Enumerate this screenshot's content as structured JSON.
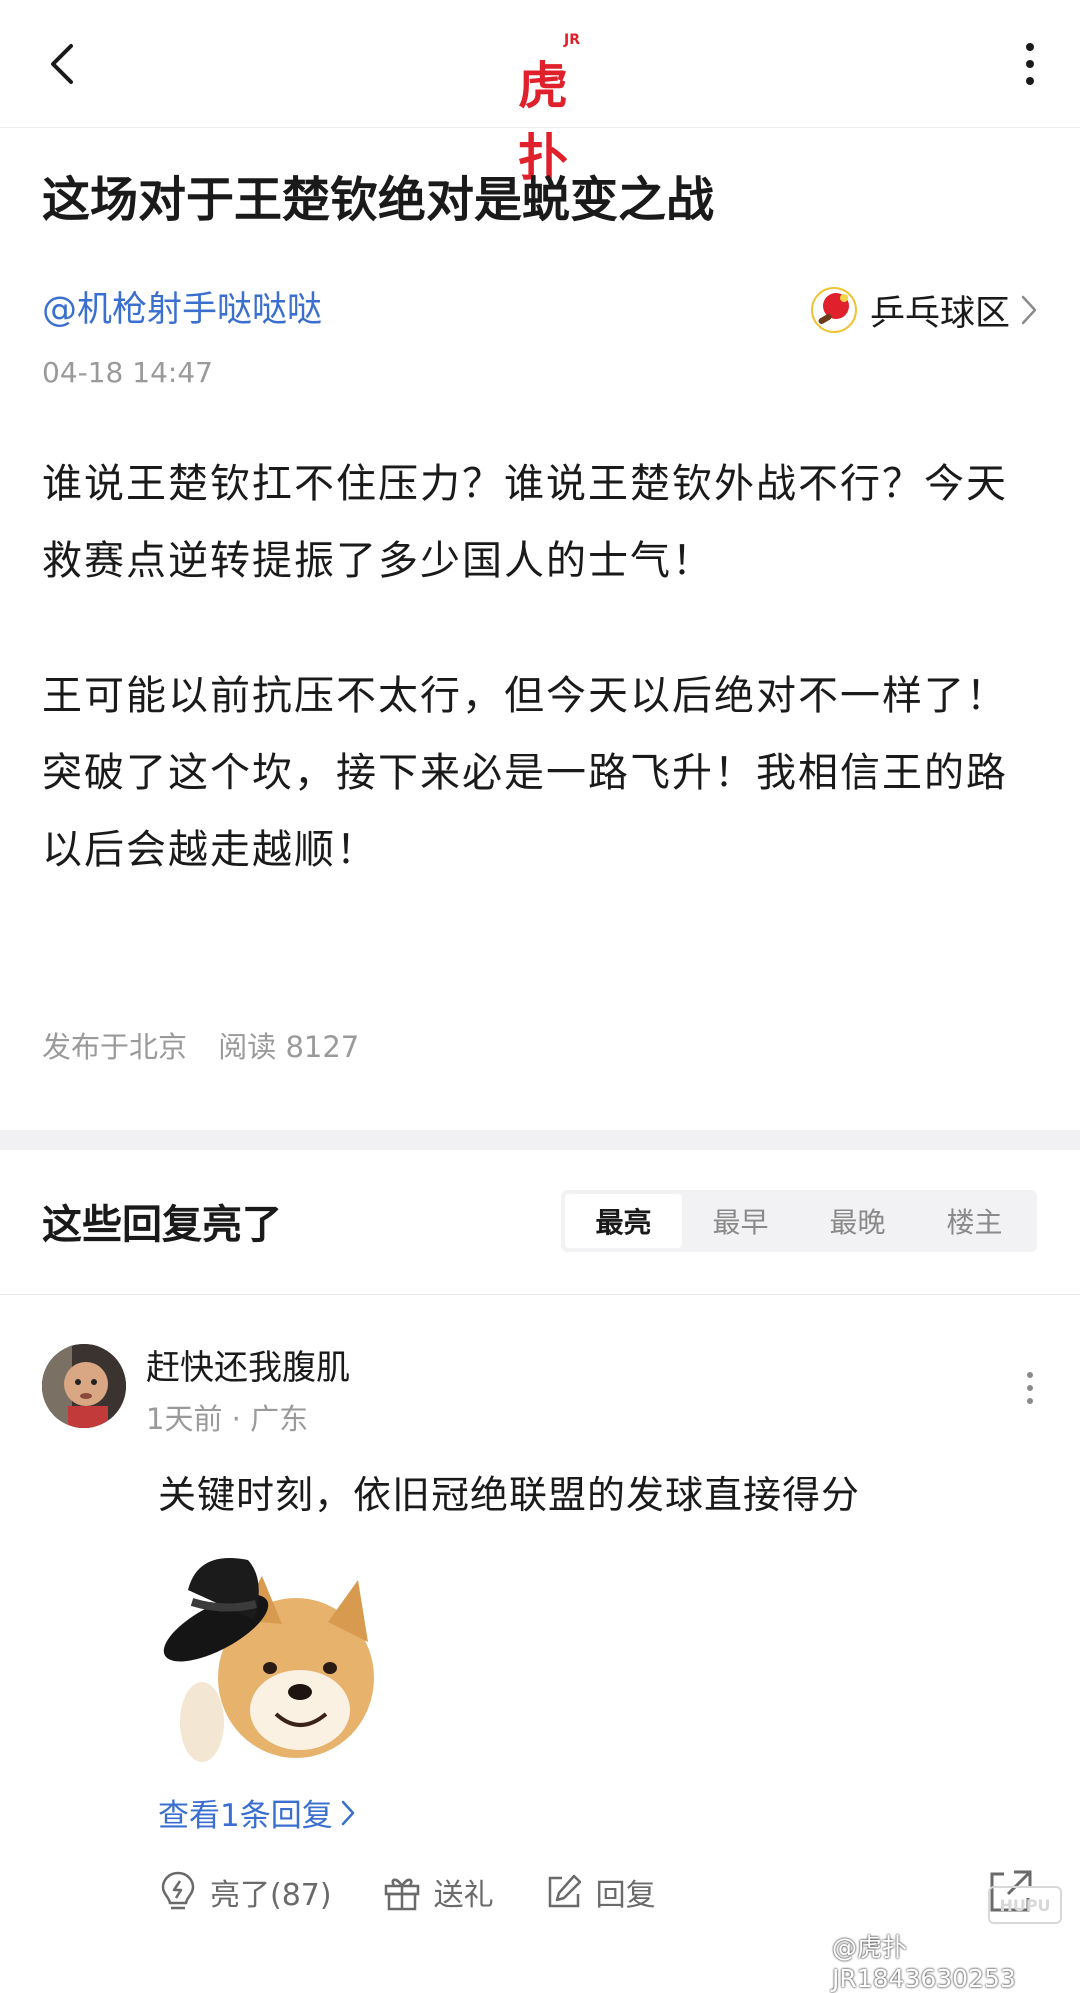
{
  "header": {
    "logo_text": "虎扑",
    "logo_badge": "JR",
    "back_icon": "chevron-left-icon",
    "more_icon": "vertical-dots-icon"
  },
  "post": {
    "title": "这场对于王楚钦绝对是蜕变之战",
    "author": "@机枪射手哒哒哒",
    "forum": "乒乓球区",
    "time": "04-18 14:47",
    "body": [
      "谁说王楚钦扛不住压力？谁说王楚钦外战不行？今天救赛点逆转提振了多少国人的士气！",
      "王可能以前抗压不太行，但今天以后绝对不一样了！突破了这个坎，接下来必是一路飞升！我相信王的路以后会越走越顺！"
    ],
    "location": "发布于北京",
    "reads": "阅读 8127"
  },
  "replies_section": {
    "heading": "这些回复亮了",
    "sort_tabs": [
      "最亮",
      "最早",
      "最晚",
      "楼主"
    ],
    "active_tab": "最亮"
  },
  "reply": {
    "username": "赶快还我腹肌",
    "time_location": "1天前 · 广东",
    "text": "关键时刻，依旧冠绝联盟的发球直接得分",
    "view_replies": "查看1条回复",
    "actions": {
      "like": "亮了(87)",
      "gift": "送礼",
      "reply": "回复"
    }
  },
  "watermark": {
    "text": "@虎扑JR1843630253",
    "badge": "HUPU"
  },
  "colors": {
    "brand_red": "#e0202b",
    "link_blue": "#3a6fd0",
    "muted_gray": "#9a9a9a"
  }
}
